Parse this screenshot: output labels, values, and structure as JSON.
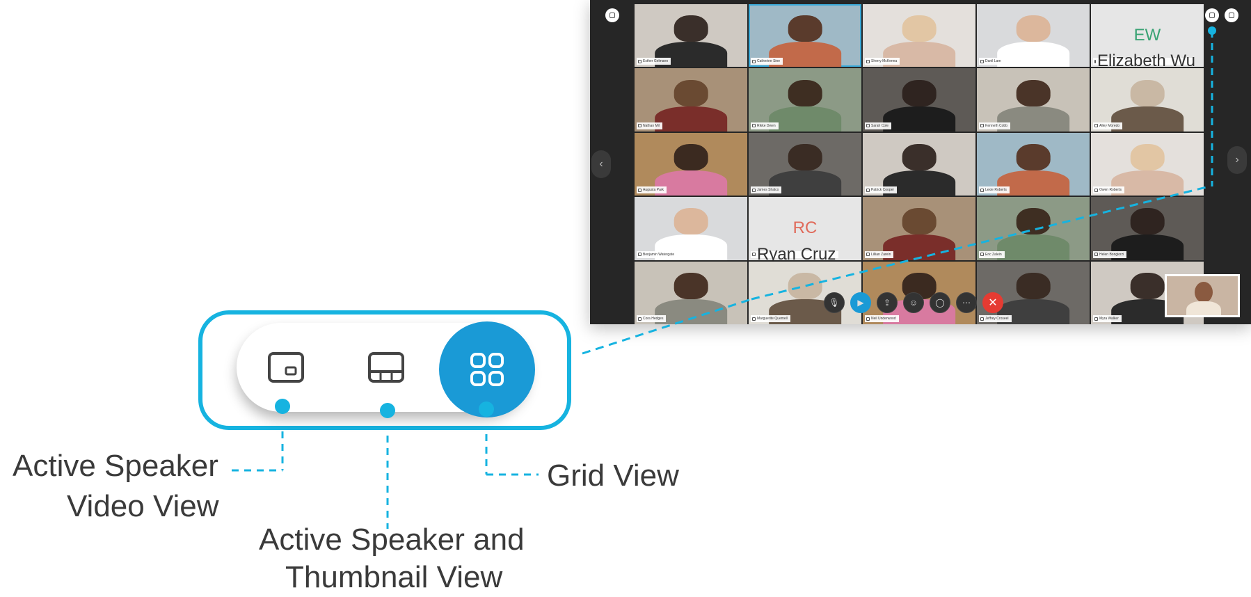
{
  "meeting": {
    "participants": [
      {
        "name": "Esther Gelmann"
      },
      {
        "name": "Catherine Sine"
      },
      {
        "name": "Sherry McKenna"
      },
      {
        "name": "Danil Lam"
      },
      {
        "name": "Elizabeth Wu",
        "initials": "EW"
      },
      {
        "name": "Nathan Mil"
      },
      {
        "name": "Rikke Dwen"
      },
      {
        "name": "Sarah Cole"
      },
      {
        "name": "Kenneth Cobb"
      },
      {
        "name": "Alley Moredo"
      },
      {
        "name": "Augusta Park"
      },
      {
        "name": "James Shalco"
      },
      {
        "name": "Patrick Cooper"
      },
      {
        "name": "Lexie Roberts"
      },
      {
        "name": "Owen Roberts"
      },
      {
        "name": "Benjamin Watergate"
      },
      {
        "name": "Ryan Cruz",
        "initials": "RC"
      },
      {
        "name": "Lillian Zarein"
      },
      {
        "name": "Eric Zalein"
      },
      {
        "name": "Helen Bongiorzi"
      },
      {
        "name": "Cora Hedges"
      },
      {
        "name": "Marguerite Quemell"
      },
      {
        "name": "Neil Underwood"
      },
      {
        "name": "Jeffrey Croseel"
      },
      {
        "name": "Myra Walker"
      }
    ]
  },
  "view_switcher": {
    "active_view": "grid"
  },
  "labels": {
    "active_speaker_line1": "Active Speaker",
    "active_speaker_line2": "Video View",
    "thumbnail_line1": "Active Speaker and",
    "thumbnail_line2": "Thumbnail View",
    "grid": "Grid View"
  },
  "colors": {
    "accent": "#16b3e0",
    "grid_button": "#1a9ad6",
    "end_call": "#e53b32",
    "meeting_bg": "#262626"
  }
}
